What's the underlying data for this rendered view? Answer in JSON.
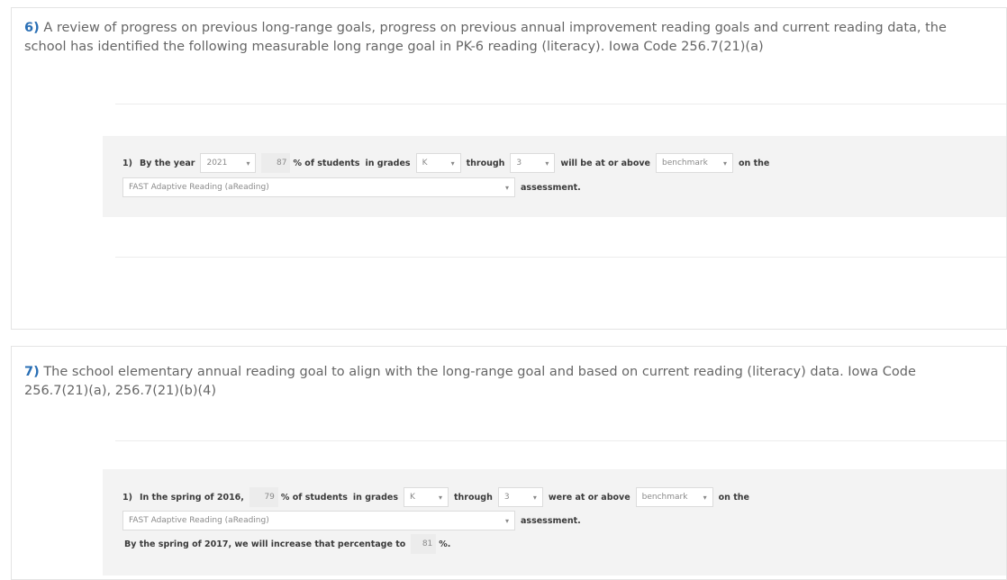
{
  "q6": {
    "number": "6)",
    "text": "A review of progress on previous long-range goals, progress on previous annual improvement reading goals and current reading data, the school has identified the following measurable long range goal in PK-6 reading (literacy). Iowa Code 256.7(21)(a)",
    "goal": {
      "index": "1)",
      "by_year_label": "By the year",
      "year": "2021",
      "percent": "87",
      "pct_students_label": "% of students",
      "in_grades_label": "in grades",
      "grade_from": "K",
      "through_label": "through",
      "grade_to": "3",
      "at_above_label": "will be at or above",
      "level": "benchmark",
      "on_the_label": "on the",
      "assessment_select": "FAST Adaptive Reading (aReading)",
      "assessment_label": "assessment."
    }
  },
  "q7": {
    "number": "7)",
    "text": "The school elementary annual reading goal to align with the long-range goal and based on current reading (literacy) data. Iowa Code 256.7(21)(a), 256.7(21)(b)(4)",
    "goal": {
      "index": "1)",
      "spring_label": "In the spring of 2016,",
      "percent": "79",
      "pct_students_label": "% of students",
      "in_grades_label": "in grades",
      "grade_from": "K",
      "through_label": "through",
      "grade_to": "3",
      "at_above_label": "were at or above",
      "level": "benchmark",
      "on_the_label": "on the",
      "assessment_select": "FAST Adaptive Reading (aReading)",
      "assessment_label": "assessment.",
      "increase_label": "By the spring of 2017,  we will increase that percentage to",
      "target_percent": "81",
      "target_suffix": "%."
    }
  },
  "colors": {
    "question_number": "#2a6fb5",
    "goal_background": "#f3f3f3",
    "border": "#e4e4e4"
  },
  "icons": {
    "select_caret": "caret-down-icon"
  }
}
